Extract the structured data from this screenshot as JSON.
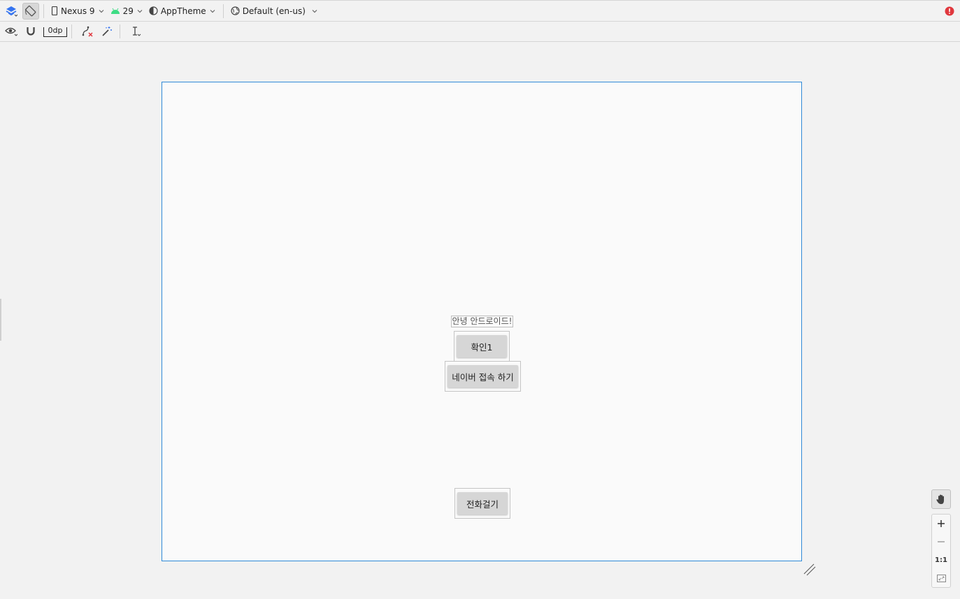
{
  "toolbar": {
    "device": "Nexus 9",
    "api_level": "29",
    "theme": "AppTheme",
    "locale": "Default (en-us)",
    "default_margin": "0dp"
  },
  "layout": {
    "hello_text": "안녕 안드로이드!",
    "confirm_button": "확인1",
    "naver_button": "네이버 접속 하기",
    "call_button": "전화걸기"
  },
  "zoom": {
    "actual_size": "1:1"
  },
  "colors": {
    "selection_border": "#2f8ad8",
    "error": "#e0383e",
    "android_green": "#3ddc84",
    "layers_blue": "#3574f0"
  }
}
